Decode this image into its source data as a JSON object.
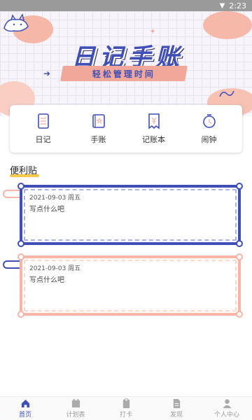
{
  "status_bar": {
    "time": "2:23"
  },
  "banner": {
    "title": "日记手账",
    "subtitle": "轻松管理时间"
  },
  "features": [
    {
      "label": "日记",
      "icon": "diary-icon"
    },
    {
      "label": "手账",
      "icon": "notebook-icon"
    },
    {
      "label": "记账本",
      "icon": "ledger-icon"
    },
    {
      "label": "闹钟",
      "icon": "alarm-clock-icon"
    }
  ],
  "section": {
    "title": "便利贴"
  },
  "notes": [
    {
      "date": "2021-09-03 周五",
      "text": "写点什么吧"
    },
    {
      "date": "2021-09-03 周五",
      "text": "写点什么吧"
    }
  ],
  "nav": [
    {
      "label": "首页",
      "icon": "home-icon",
      "active": true
    },
    {
      "label": "计划表",
      "icon": "calendar-icon",
      "active": false
    },
    {
      "label": "打卡",
      "icon": "clipboard-icon",
      "active": false
    },
    {
      "label": "发现",
      "icon": "document-icon",
      "active": false
    },
    {
      "label": "个人中心",
      "icon": "user-icon",
      "active": false
    }
  ],
  "colors": {
    "primary": "#3f4fb5",
    "accent": "#f7b4a7",
    "highlight": "#f6c94a"
  }
}
